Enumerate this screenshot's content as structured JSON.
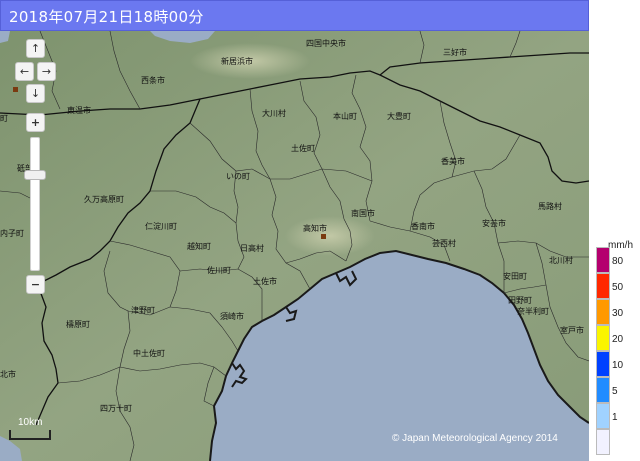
{
  "header": {
    "title": "2018年07月21日18時00分"
  },
  "map": {
    "places": [
      {
        "name": "四国中央市"
      },
      {
        "name": "新居浜市"
      },
      {
        "name": "三好市"
      },
      {
        "name": "西条市"
      },
      {
        "name": "東温市"
      },
      {
        "name": "大川村"
      },
      {
        "name": "本山町"
      },
      {
        "name": "大豊町"
      },
      {
        "name": "土佐町"
      },
      {
        "name": "香美市"
      },
      {
        "name": "いの町"
      },
      {
        "name": "久万高原町"
      },
      {
        "name": "馬路村"
      },
      {
        "name": "仁淀川町"
      },
      {
        "name": "南国市"
      },
      {
        "name": "香南市"
      },
      {
        "name": "安芸市"
      },
      {
        "name": "高知市"
      },
      {
        "name": "越知町"
      },
      {
        "name": "日高村"
      },
      {
        "name": "芸西村"
      },
      {
        "name": "北川村"
      },
      {
        "name": "佐川町"
      },
      {
        "name": "安田町"
      },
      {
        "name": "土佐市"
      },
      {
        "name": "田野町"
      },
      {
        "name": "奈半利町"
      },
      {
        "name": "檮原町"
      },
      {
        "name": "津野町"
      },
      {
        "name": "須崎市"
      },
      {
        "name": "室戸市"
      },
      {
        "name": "中土佐町"
      },
      {
        "name": "四万十町"
      },
      {
        "name": "砥部"
      },
      {
        "name": "内子町"
      },
      {
        "name": "北市"
      },
      {
        "name": "町"
      }
    ],
    "controls": {
      "pan_up": "↑",
      "pan_left": "←",
      "pan_right": "→",
      "pan_down": "↓",
      "zoom_in": "+",
      "zoom_out": "−"
    },
    "scale_label": "10km",
    "copyright": "© Japan Meteorological Agency 2014"
  },
  "legend": {
    "unit": "mm/h",
    "levels": [
      {
        "value": "80",
        "color": "#b4006e"
      },
      {
        "value": "50",
        "color": "#ff2800"
      },
      {
        "value": "30",
        "color": "#ff9900"
      },
      {
        "value": "20",
        "color": "#faf500"
      },
      {
        "value": "10",
        "color": "#0041ff"
      },
      {
        "value": "5",
        "color": "#218cff"
      },
      {
        "value": "1",
        "color": "#a0d2ff"
      },
      {
        "value": "",
        "color": "#f2f2ff"
      }
    ]
  },
  "colors": {
    "title_bar": "#6b78f0",
    "sea": "#9aacc5",
    "land": "#8fa07c"
  }
}
